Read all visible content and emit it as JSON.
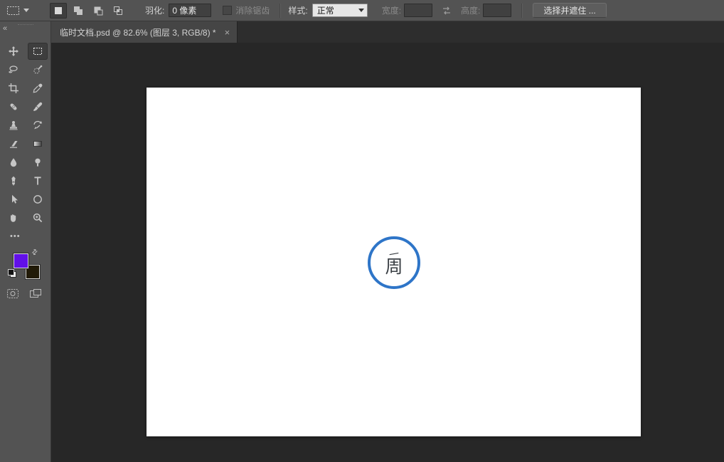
{
  "colors": {
    "accent_blue": "#2e75c8",
    "foreground_swatch": "#6110e8",
    "background_swatch": "#211a07"
  },
  "options_bar": {
    "feather_label": "羽化:",
    "feather_value": "0 像素",
    "antialias_label": "消除锯齿",
    "style_label": "样式:",
    "style_value": "正常",
    "width_label": "宽度:",
    "width_value": "",
    "height_label": "高度:",
    "height_value": "",
    "select_and_mask_label": "选择并遮住 ..."
  },
  "tab": {
    "title": "临时文档.psd @ 82.6% (图层 3, RGB/8) *",
    "close": "×"
  },
  "toolbar": {
    "collapse": "«",
    "more": "•••"
  },
  "document": {
    "logo_top": "一",
    "logo_char": "周"
  }
}
